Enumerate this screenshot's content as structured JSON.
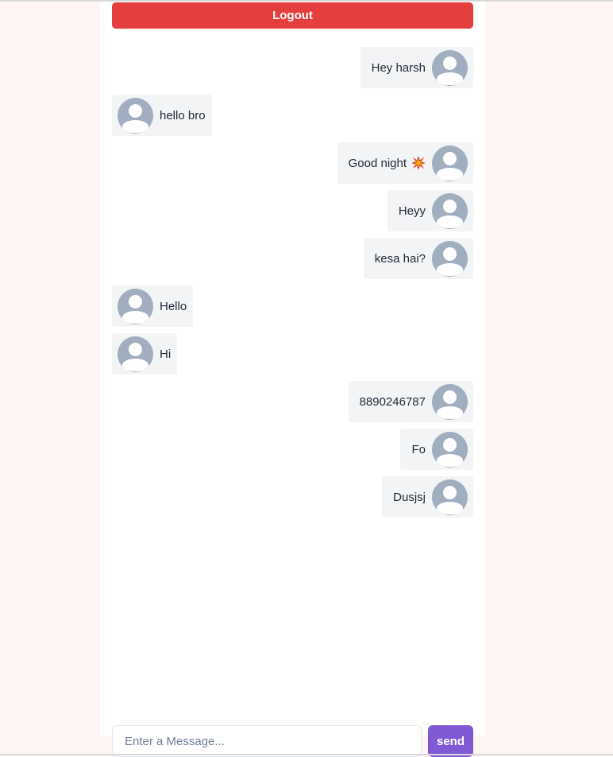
{
  "header": {
    "logout_label": "Logout"
  },
  "messages": [
    {
      "side": "right",
      "text": "Hey harsh",
      "emoji": false
    },
    {
      "side": "left",
      "text": "hello bro",
      "emoji": false
    },
    {
      "side": "right",
      "text": "Good night",
      "emoji": true,
      "emoji_name": "collision-emoji"
    },
    {
      "side": "right",
      "text": "Heyy",
      "emoji": false
    },
    {
      "side": "right",
      "text": "kesa hai?",
      "emoji": false
    },
    {
      "side": "left",
      "text": "Hello",
      "emoji": false
    },
    {
      "side": "left",
      "text": "Hi",
      "emoji": false
    },
    {
      "side": "right",
      "text": "8890246787",
      "emoji": false
    },
    {
      "side": "right",
      "text": "Fo",
      "emoji": false
    },
    {
      "side": "right",
      "text": "Dusjsj",
      "emoji": false
    }
  ],
  "composer": {
    "placeholder": "Enter a Message...",
    "value": "",
    "send_label": "send"
  },
  "colors": {
    "logout_bg": "#e53e3e",
    "send_bg": "#805ad5",
    "bubble_bg": "#f3f4f6",
    "avatar_bg": "#a0aec0",
    "page_bg": "#fff5f4"
  }
}
